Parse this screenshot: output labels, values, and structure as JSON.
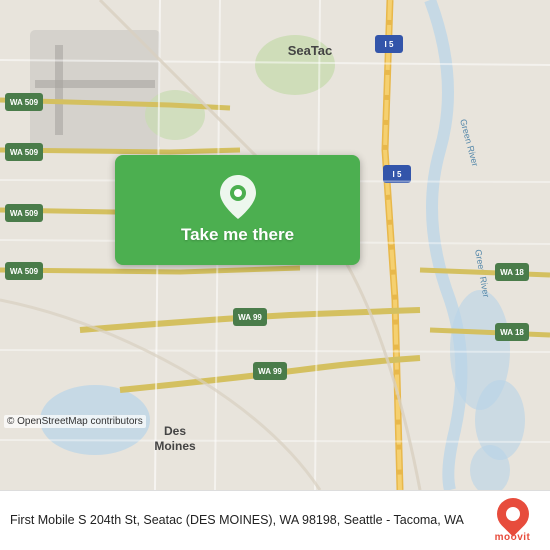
{
  "map": {
    "attribution": "© OpenStreetMap contributors",
    "overlay_button_label": "Take me there",
    "accent_color": "#4caf50"
  },
  "bottom_bar": {
    "address": "First Mobile S 204th St, Seatac (DES MOINES), WA 98198, Seattle - Tacoma, WA"
  },
  "moovit": {
    "label": "moovit"
  },
  "roads": {
    "wa509_labels": [
      "WA 509",
      "WA 509",
      "WA 509",
      "WA 509"
    ],
    "wa99_labels": [
      "WA 99",
      "WA 99"
    ],
    "i5_labels": [
      "I 5",
      "I 5"
    ],
    "wa18_labels": [
      "WA 18",
      "WA 18"
    ],
    "seatac_label": "SeaTac",
    "des_moines_label": "Des Moines",
    "green_river_label": "Green River"
  }
}
